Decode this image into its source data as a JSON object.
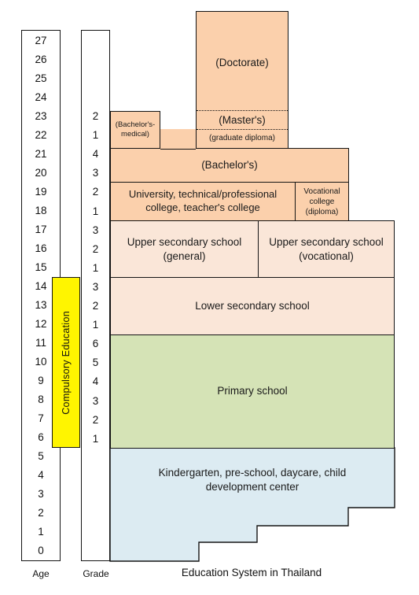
{
  "title": "Education System in Thailand",
  "axes": {
    "age_label": "Age",
    "grade_label": "Grade",
    "age_ticks": [
      27,
      26,
      25,
      24,
      23,
      22,
      21,
      20,
      19,
      18,
      17,
      16,
      15,
      14,
      13,
      12,
      11,
      10,
      9,
      8,
      7,
      6,
      5,
      4,
      3,
      2,
      1,
      0
    ],
    "grade_ticks_by_age": {
      "23": "2",
      "22": "1",
      "21": "4",
      "20": "3",
      "19": "2",
      "18": "1",
      "17": "3",
      "16": "2",
      "15": "1",
      "14": "3",
      "13": "2",
      "12": "1",
      "11": "6",
      "10": "5",
      "9": "4",
      "8": "3",
      "7": "2",
      "6": "1"
    }
  },
  "compulsory": {
    "label": "Compulsory Education",
    "color": "#FFF500",
    "age_from": 6,
    "age_to": 14
  },
  "colors": {
    "tertiary_orange": "#FBD0AC",
    "secondary_peach": "#FAE6D8",
    "primary_green": "#D5E3B6",
    "preschool_blue": "#DCEBF2",
    "outline": "#141414",
    "page_background": "#FFFFFF"
  },
  "blocks": [
    {
      "id": "doctorate",
      "label": "(Doctorate)",
      "color": "#FBD0AC"
    },
    {
      "id": "masters",
      "label": "(Master's)",
      "color": "#FBD0AC"
    },
    {
      "id": "graduate-diploma",
      "label": "(graduate diploma)",
      "color": "#FBD0AC"
    },
    {
      "id": "bachelors-medical",
      "label": "(Bachelor's-\nmedical)",
      "color": "#FBD0AC"
    },
    {
      "id": "bachelors",
      "label": "(Bachelor's)",
      "color": "#FBD0AC"
    },
    {
      "id": "university",
      "label": "University, technical/professional\ncollege, teacher's college",
      "color": "#FBD0AC"
    },
    {
      "id": "vocational-college",
      "label": "Vocational\ncollege\n(diploma)",
      "color": "#FBD0AC"
    },
    {
      "id": "upper-secondary-general",
      "label": "Upper secondary school\n(general)",
      "color": "#FAE6D8"
    },
    {
      "id": "upper-secondary-vocational",
      "label": "Upper secondary school\n(vocational)",
      "color": "#FAE6D8"
    },
    {
      "id": "lower-secondary",
      "label": "Lower secondary school",
      "color": "#FAE6D8"
    },
    {
      "id": "primary",
      "label": "Primary school",
      "color": "#D5E3B6"
    },
    {
      "id": "kindergarten",
      "label": "Kindergarten, pre-school, daycare, child\ndevelopment center",
      "color": "#DCEBF2"
    }
  ]
}
